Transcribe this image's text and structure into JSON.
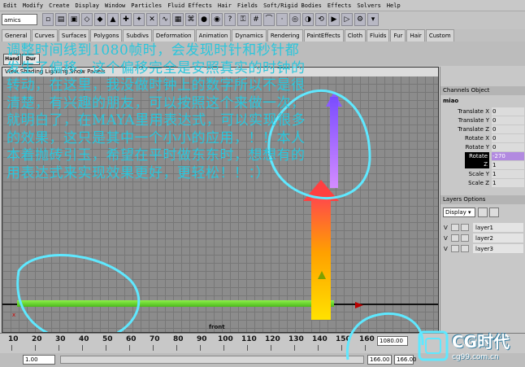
{
  "menu": [
    "Edit",
    "Modify",
    "Create",
    "Display",
    "Window",
    "Particles",
    "Fluid Effects",
    "Hair",
    "Fields",
    "Soft/Rigid Bodies",
    "Effects",
    "Solvers",
    "Help"
  ],
  "mode_selector": "amics",
  "shelf_tabs": [
    "General",
    "Curves",
    "Surfaces",
    "Polygons",
    "Subdivs",
    "Deformation",
    "Animation",
    "Dynamics",
    "Rendering",
    "PaintEffects",
    "Cloth",
    "Fluids",
    "Fur",
    "Hair",
    "Custom"
  ],
  "shelf_buttons": [
    "Hand",
    "Dur"
  ],
  "panel_menu": "View Shading Lighting Show Panels",
  "viewport_label": "front",
  "axis_label": "x",
  "annotation": "调整时间线到1080帧时，会发现时针和秒针都发生了偏移，这个偏移完全是安照真实的时钟的转动，在这里，我没做时钟上的数字所以不是很清楚，有兴趣的朋友，可以按照这个来做一次，就明白了，在MAYA里用表达式，可以实现很多的效果，这只是其中一个小小的应用，！！本人本着抛砖引玉，希望在平时做东东时，想想有的用表达式来实现效果更好，更轻松！！：）",
  "channels": {
    "header": "Channels Object",
    "object": "miao",
    "rows": [
      {
        "label": "Translate X",
        "value": "0"
      },
      {
        "label": "Translate Y",
        "value": "0"
      },
      {
        "label": "Translate Z",
        "value": "0"
      },
      {
        "label": "Rotate X",
        "value": "0"
      },
      {
        "label": "Rotate Y",
        "value": "0"
      },
      {
        "label": "Rotate Z",
        "value": "-270"
      },
      {
        "label": "Scale X",
        "value": "1"
      },
      {
        "label": "Scale Y",
        "value": "1"
      },
      {
        "label": "Scale Z",
        "value": "1"
      }
    ]
  },
  "layers": {
    "header": "Layers Options",
    "display": "Display",
    "items": [
      {
        "visible": "V",
        "name": "layer1"
      },
      {
        "visible": "V",
        "name": "layer2"
      },
      {
        "visible": "V",
        "name": "layer3"
      }
    ]
  },
  "timeline": {
    "ticks": [
      "10",
      "20",
      "30",
      "40",
      "50",
      "60",
      "70",
      "80",
      "90",
      "100",
      "110",
      "120",
      "130",
      "140",
      "150",
      "160"
    ],
    "current_frame": "1080.00"
  },
  "range": {
    "start": "1.00",
    "end": "166.00",
    "end2": "166.00"
  },
  "logo": {
    "text": "CG时代",
    "url": "cg99.com.cn"
  },
  "colors": {
    "annotation": "#2ac6dc",
    "viewport": "#8c8c8c",
    "hour_hand": "#ffa000",
    "minute_hand": "#8a5cff",
    "axis": "#4cb81c"
  }
}
